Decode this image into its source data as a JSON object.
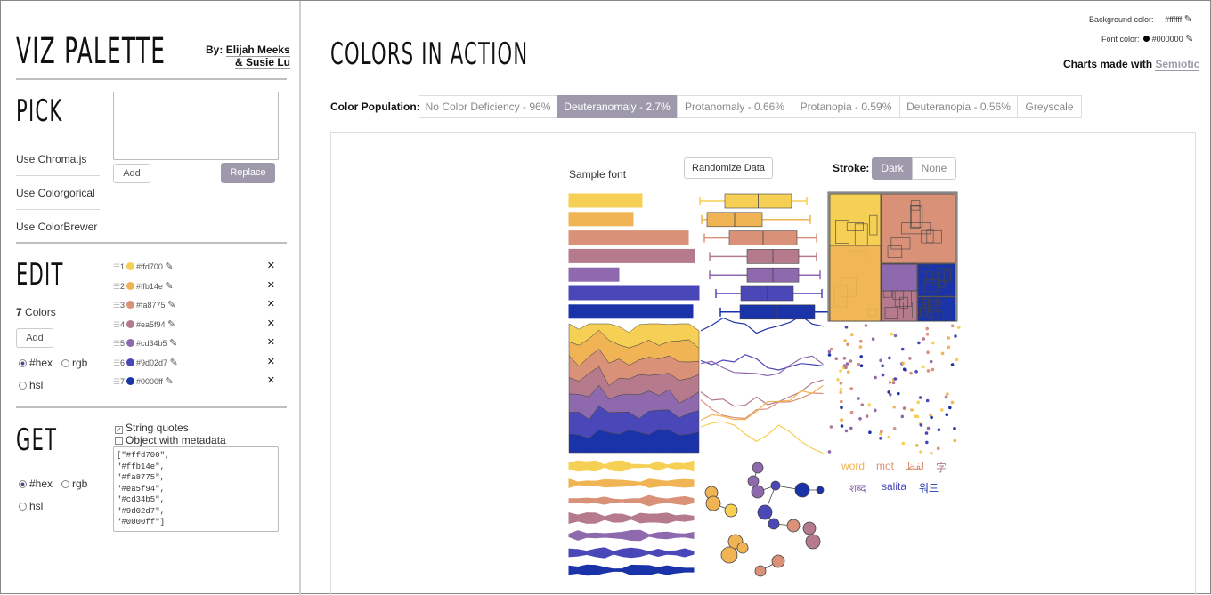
{
  "sidebar": {
    "title": "VIZ PALETTE",
    "byline_prefix": "By:",
    "author1": "Elijah Meeks",
    "author2": "& Susie Lu",
    "pick": {
      "heading": "PICK",
      "links": [
        "Use Chroma.js",
        "Use Colorgorical",
        "Use ColorBrewer"
      ],
      "add_label": "Add",
      "replace_label": "Replace"
    },
    "edit": {
      "heading": "EDIT",
      "count_num": "7",
      "count_label": "Colors",
      "add_label": "Add",
      "formats": [
        "#hex",
        "rgb",
        "hsl"
      ],
      "colors": [
        {
          "n": "1",
          "hex": "#ffd700"
        },
        {
          "n": "2",
          "hex": "#ffb14e"
        },
        {
          "n": "3",
          "hex": "#fa8775"
        },
        {
          "n": "4",
          "hex": "#ea5f94"
        },
        {
          "n": "5",
          "hex": "#cd34b5"
        },
        {
          "n": "6",
          "hex": "#9d02d7"
        },
        {
          "n": "7",
          "hex": "#0000ff"
        }
      ],
      "remove_glyph": "✕",
      "pencil_glyph": "✎",
      "drag_glyph": "☰"
    },
    "get": {
      "heading": "GET",
      "string_quotes": "String quotes",
      "object_metadata": "Object with metadata",
      "formats": [
        "#hex",
        "rgb",
        "hsl"
      ],
      "output": "[\"#ffd700\",\n\"#ffb14e\",\n\"#fa8775\",\n\"#ea5f94\",\n\"#cd34b5\",\n\"#9d02d7\",\n\"#0000ff\"]"
    }
  },
  "header": {
    "title": "COLORS IN ACTION",
    "bg_label": "Background color:",
    "bg_value": "#ffffff",
    "font_label": "Font color:",
    "font_value": "#000000",
    "charts_made_with": "Charts made with",
    "semiotic": "Semiotic"
  },
  "population": {
    "label": "Color Population:",
    "tabs": [
      "No Color Deficiency - 96%",
      "Deuteranomaly - 2.7%",
      "Protanomaly - 0.66%",
      "Protanopia - 0.59%",
      "Deuteranopia - 0.56%",
      "Greyscale"
    ],
    "active": 1
  },
  "panel": {
    "sample_font": "Sample font",
    "randomize": "Randomize Data",
    "stroke_label": "Stroke:",
    "stroke_dark": "Dark",
    "stroke_none": "None",
    "words": [
      "word",
      "mot",
      "لفظ",
      "字",
      "शब्द",
      "salita",
      "워드"
    ]
  },
  "palette_rendered": [
    "#f6cf55",
    "#f0b454",
    "#d99178",
    "#b57b8d",
    "#8e69ad",
    "#4a47b8",
    "#1b33a8"
  ],
  "accent": "#9e9aab"
}
